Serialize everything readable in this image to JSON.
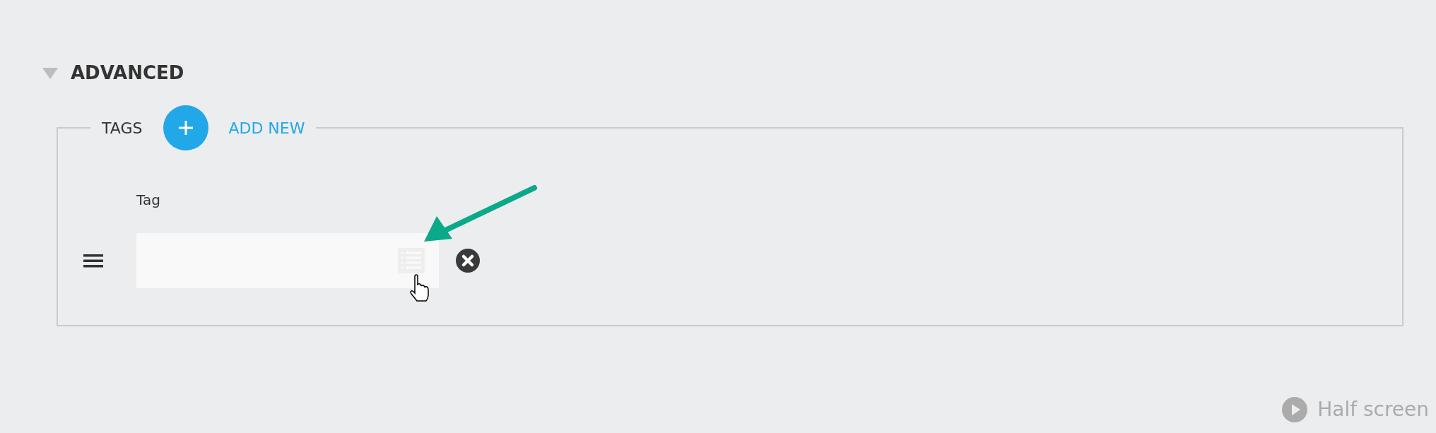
{
  "section": {
    "title": "ADVANCED",
    "expanded": true
  },
  "tags": {
    "legend": "TAGS",
    "add_label": "ADD NEW",
    "rows": [
      {
        "label": "Tag"
      }
    ]
  },
  "footer": {
    "half_screen": "Half screen"
  }
}
